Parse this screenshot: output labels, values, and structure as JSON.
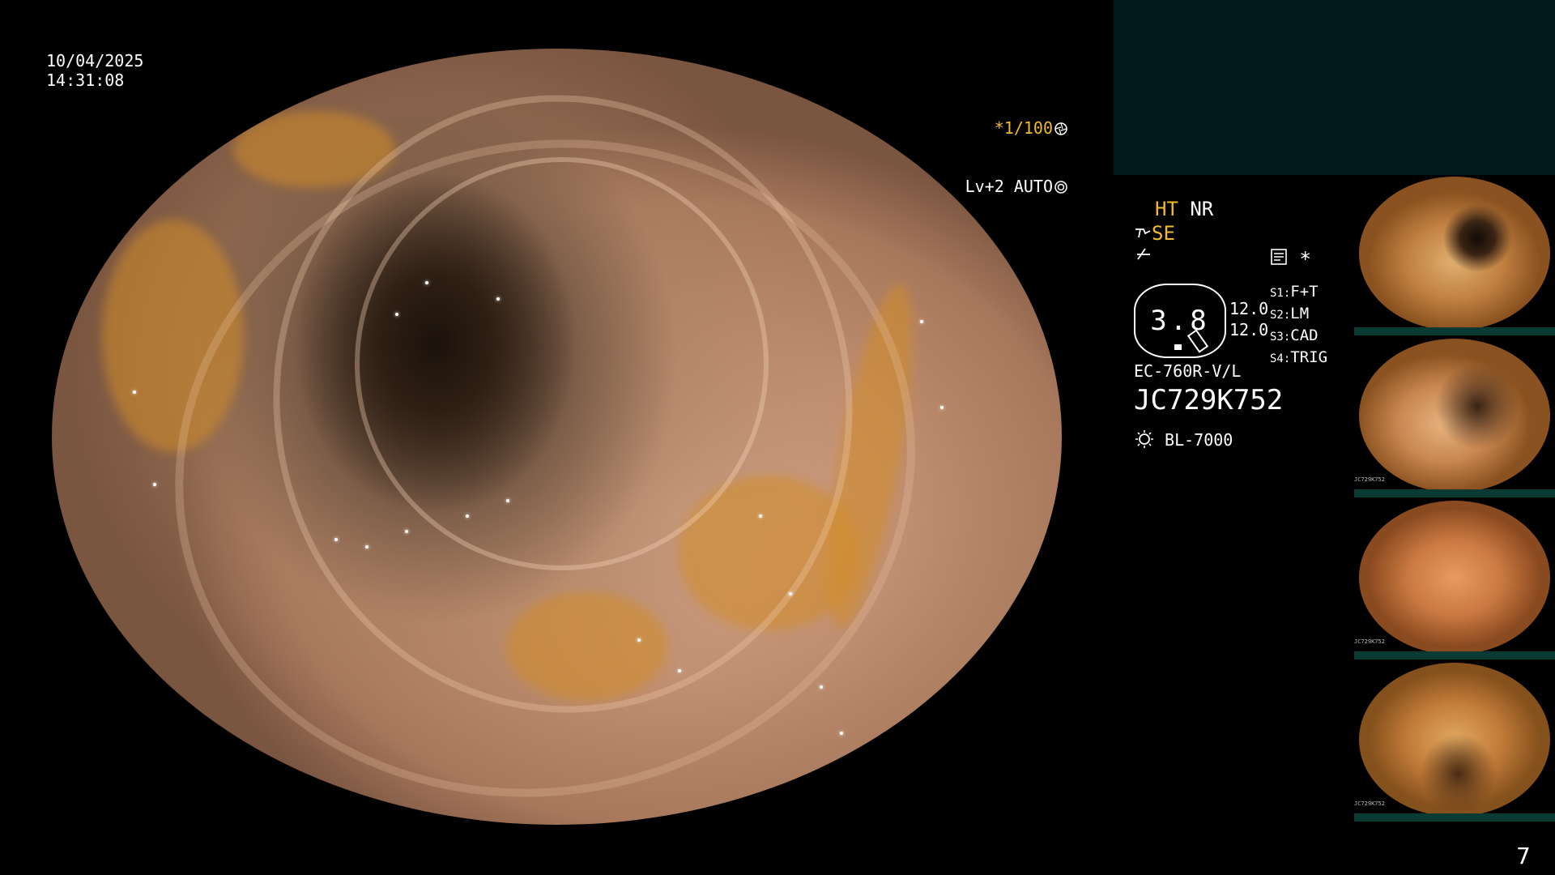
{
  "overlay": {
    "date": "10/04/2025",
    "time": "14:31:08",
    "shutter": "*1/100",
    "level": "Lv+2 AUTO"
  },
  "settings": {
    "ht": "HT",
    "nr": "NR",
    "se": "SE",
    "scope_value": "3.8",
    "left_values": [
      "12.0",
      "12.0"
    ],
    "switches": [
      {
        "key": "S1:",
        "value": "F+T"
      },
      {
        "key": "S2:",
        "value": "LM"
      },
      {
        "key": "S3:",
        "value": "CAD"
      },
      {
        "key": "S4:",
        "value": "TRIG"
      }
    ],
    "scope_model": "EC-760R-V/L",
    "serial": "JC729K752",
    "light_source": "BL-7000",
    "asterisk": "*"
  },
  "thumbnails": {
    "count": 4,
    "serial_caption": "JC729K752"
  },
  "page_number": "7",
  "colors": {
    "highlight": "#f2b92e",
    "top_panel": "#021a1b",
    "thumb_strip": "#0b3a33"
  },
  "icons": [
    "aperture-icon",
    "iris-icon",
    "scope-icon",
    "signal-icon",
    "memo-icon",
    "light-icon"
  ]
}
